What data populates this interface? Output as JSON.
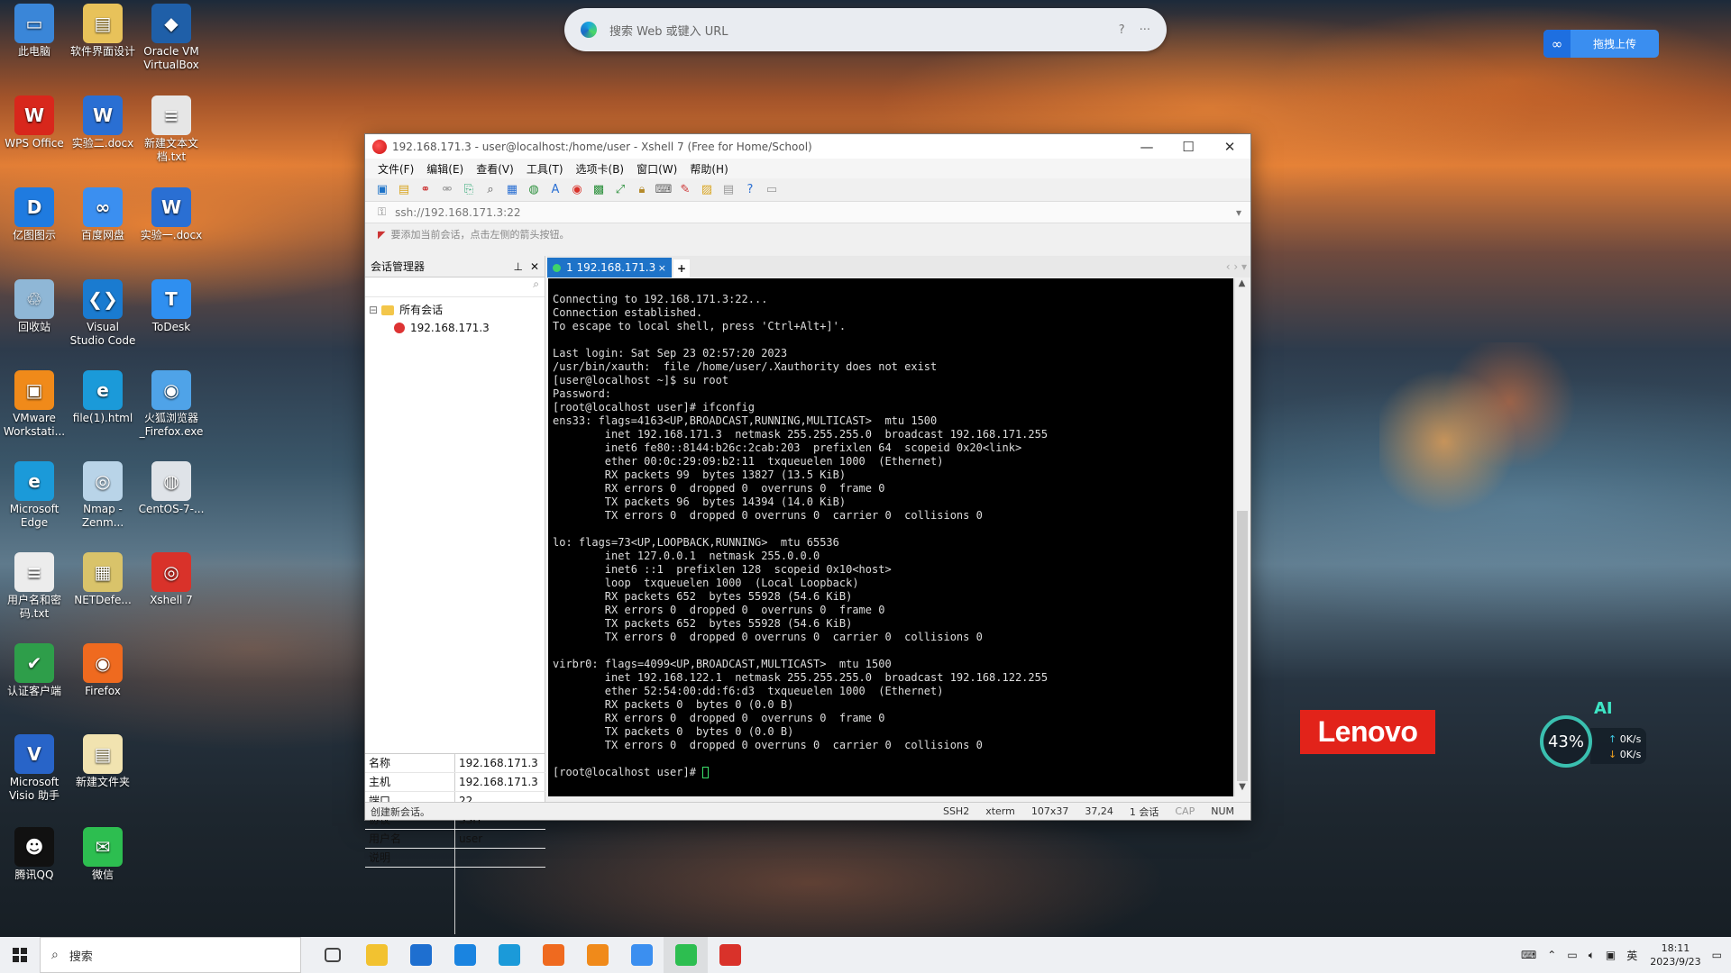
{
  "desktop": {
    "icons": [
      {
        "label": "此电脑",
        "color": "#3a86d8",
        "glyph": "▭"
      },
      {
        "label": "软件界面设计",
        "color": "#e8c25a",
        "glyph": "▤"
      },
      {
        "label": "Oracle VM VirtualBox",
        "color": "#1f5fa8",
        "glyph": "◆"
      },
      {
        "label": "WPS Office",
        "color": "#d8271c",
        "glyph": "W"
      },
      {
        "label": "实验二.docx",
        "color": "#2a6fd3",
        "glyph": "W"
      },
      {
        "label": "新建文本文档.txt",
        "color": "#e6e6e6",
        "glyph": "≡"
      },
      {
        "label": "亿图图示",
        "color": "#1f7be0",
        "glyph": "D"
      },
      {
        "label": "百度网盘",
        "color": "#3b8ff0",
        "glyph": "∞"
      },
      {
        "label": "实验一.docx",
        "color": "#2a6fd3",
        "glyph": "W"
      },
      {
        "label": "回收站",
        "color": "#8fb7d6",
        "glyph": "♲"
      },
      {
        "label": "Visual Studio Code",
        "color": "#1a7bd0",
        "glyph": "❮❯"
      },
      {
        "label": "ToDesk",
        "color": "#2f8ff0",
        "glyph": "T"
      },
      {
        "label": "VMware Workstati...",
        "color": "#f08a1a",
        "glyph": "▣"
      },
      {
        "label": "file(1).html",
        "color": "#1b9ad9",
        "glyph": "e"
      },
      {
        "label": "火狐浏览器_Firefox.exe",
        "color": "#4fa3e8",
        "glyph": "◉"
      },
      {
        "label": "Microsoft Edge",
        "color": "#1b9ad9",
        "glyph": "e"
      },
      {
        "label": "Nmap - Zenm...",
        "color": "#b9d4e8",
        "glyph": "◎"
      },
      {
        "label": "CentOS-7-...",
        "color": "#dfe3e8",
        "glyph": "◍"
      },
      {
        "label": "用户名和密码.txt",
        "color": "#ececec",
        "glyph": "≡"
      },
      {
        "label": "NETDefe...",
        "color": "#d9c36a",
        "glyph": "▦"
      },
      {
        "label": "Xshell 7",
        "color": "#d9322a",
        "glyph": "◎"
      },
      {
        "label": "认证客户端",
        "color": "#2e9e4a",
        "glyph": "✔"
      },
      {
        "label": "Firefox",
        "color": "#ef6a1f",
        "glyph": "◉"
      },
      {
        "label": "Microsoft Visio 助手",
        "color": "#2864c8",
        "glyph": "V"
      },
      {
        "label": "新建文件夹",
        "color": "#f1e3b0",
        "glyph": "▤"
      },
      {
        "label": "腾讯QQ",
        "color": "#111111",
        "glyph": "☻"
      },
      {
        "label": "微信",
        "color": "#2dbe50",
        "glyph": "✉"
      }
    ]
  },
  "edge_bar": {
    "placeholder": "搜索 Web 或键入 URL",
    "help": "?",
    "more": "···"
  },
  "baidu_upload": {
    "label": "拖拽上传"
  },
  "lenovo": {
    "logo": "Lenovo"
  },
  "net_widget": {
    "ai": "AI",
    "percent": "43%",
    "up": "0K/s",
    "down": "0K/s"
  },
  "xshell": {
    "title": "192.168.171.3 - user@localhost:/home/user - Xshell 7 (Free for Home/School)",
    "menu": [
      "文件(F)",
      "编辑(E)",
      "查看(V)",
      "工具(T)",
      "选项卡(B)",
      "窗口(W)",
      "帮助(H)"
    ],
    "address": "ssh://192.168.171.3:22",
    "hint": "要添加当前会话，点击左侧的箭头按钮。",
    "session_manager": {
      "title": "会话管理器",
      "root": "所有会话",
      "session": "192.168.171.3"
    },
    "properties": [
      {
        "key": "名称",
        "value": "192.168.171.3"
      },
      {
        "key": "主机",
        "value": "192.168.171.3"
      },
      {
        "key": "端口",
        "value": "22"
      },
      {
        "key": "协议",
        "value": "SSH"
      },
      {
        "key": "用户名",
        "value": "user"
      },
      {
        "key": "说明",
        "value": ""
      }
    ],
    "tab": {
      "label": "1 192.168.171.3",
      "close": "×",
      "add": "+"
    },
    "terminal_lines": [
      "Connecting to 192.168.171.3:22...",
      "Connection established.",
      "To escape to local shell, press 'Ctrl+Alt+]'.",
      "",
      "Last login: Sat Sep 23 02:57:20 2023",
      "/usr/bin/xauth:  file /home/user/.Xauthority does not exist",
      "[user@localhost ~]$ su root",
      "Password:",
      "[root@localhost user]# ifconfig",
      "ens33: flags=4163<UP,BROADCAST,RUNNING,MULTICAST>  mtu 1500",
      "        inet 192.168.171.3  netmask 255.255.255.0  broadcast 192.168.171.255",
      "        inet6 fe80::8144:b26c:2cab:203  prefixlen 64  scopeid 0x20<link>",
      "        ether 00:0c:29:09:b2:11  txqueuelen 1000  (Ethernet)",
      "        RX packets 99  bytes 13827 (13.5 KiB)",
      "        RX errors 0  dropped 0  overruns 0  frame 0",
      "        TX packets 96  bytes 14394 (14.0 KiB)",
      "        TX errors 0  dropped 0 overruns 0  carrier 0  collisions 0",
      "",
      "lo: flags=73<UP,LOOPBACK,RUNNING>  mtu 65536",
      "        inet 127.0.0.1  netmask 255.0.0.0",
      "        inet6 ::1  prefixlen 128  scopeid 0x10<host>",
      "        loop  txqueuelen 1000  (Local Loopback)",
      "        RX packets 652  bytes 55928 (54.6 KiB)",
      "        RX errors 0  dropped 0  overruns 0  frame 0",
      "        TX packets 652  bytes 55928 (54.6 KiB)",
      "        TX errors 0  dropped 0 overruns 0  carrier 0  collisions 0",
      "",
      "virbr0: flags=4099<UP,BROADCAST,MULTICAST>  mtu 1500",
      "        inet 192.168.122.1  netmask 255.255.255.0  broadcast 192.168.122.255",
      "        ether 52:54:00:dd:f6:d3  txqueuelen 1000  (Ethernet)",
      "        RX packets 0  bytes 0 (0.0 B)",
      "        RX errors 0  dropped 0  overruns 0  frame 0",
      "        TX packets 0  bytes 0 (0.0 B)",
      "        TX errors 0  dropped 0 overruns 0  carrier 0  collisions 0",
      "",
      "[root@localhost user]# "
    ],
    "status": {
      "left": "创建新会话。",
      "proto": "SSH2",
      "term": "xterm",
      "size": "107x37",
      "pos": "37,24",
      "sessions": "1 会话",
      "cap": "CAP",
      "num": "NUM"
    }
  },
  "taskbar": {
    "search_placeholder": "搜索",
    "apps": [
      {
        "name": "task-view",
        "color": "#444"
      },
      {
        "name": "file-explorer",
        "color": "#f2c230"
      },
      {
        "name": "mail",
        "color": "#1e6fd0"
      },
      {
        "name": "lenovo-app",
        "color": "#1a84e0"
      },
      {
        "name": "edge",
        "color": "#1b9ad9"
      },
      {
        "name": "firefox",
        "color": "#ef6a1f"
      },
      {
        "name": "vmware",
        "color": "#f08a1a"
      },
      {
        "name": "baidu-netdisk",
        "color": "#3b8ff0"
      },
      {
        "name": "wechat",
        "color": "#2dbe50"
      },
      {
        "name": "xshell",
        "color": "#d9322a"
      }
    ],
    "tray_ime": "英",
    "time": "18:11",
    "date": "2023/9/23"
  }
}
